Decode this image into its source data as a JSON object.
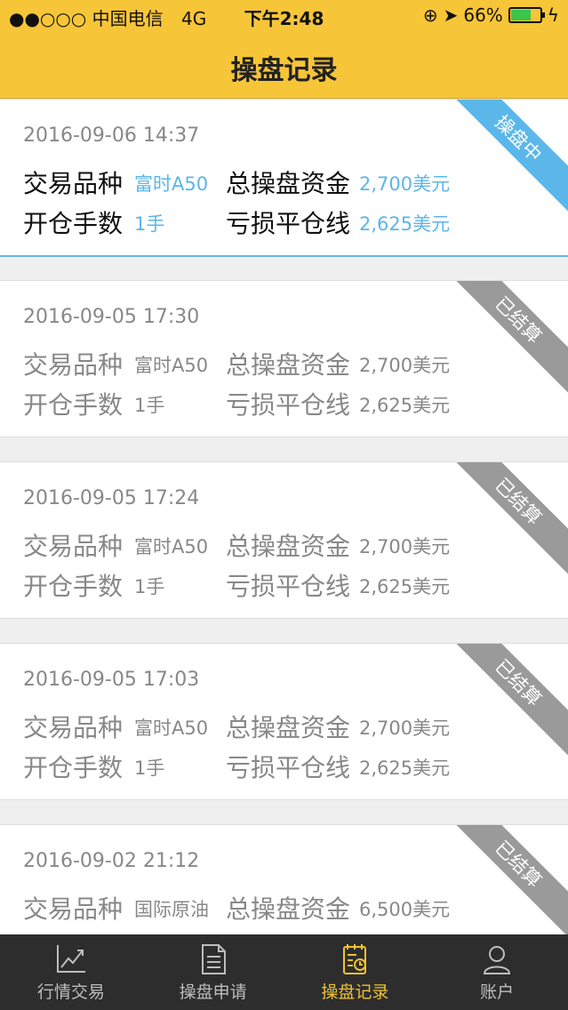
{
  "status": {
    "carrier": "●●○○○ 中国电信",
    "network": "4G",
    "time": "下午2:48",
    "battery": "66%"
  },
  "header": {
    "title": "操盘记录"
  },
  "records": [
    {
      "date": "2016-09-06 14:37",
      "status": "操盘中",
      "variety_label": "交易品种",
      "variety": "富时A50",
      "capital_label": "总操盘资金",
      "capital": "2,700美元",
      "lots_label": "开仓手数",
      "lots": "1手",
      "stop_label": "亏损平仓线",
      "stop": "2,625美元"
    },
    {
      "date": "2016-09-05 17:30",
      "status": "已结算",
      "variety_label": "交易品种",
      "variety": "富时A50",
      "capital_label": "总操盘资金",
      "capital": "2,700美元",
      "lots_label": "开仓手数",
      "lots": "1手",
      "stop_label": "亏损平仓线",
      "stop": "2,625美元"
    },
    {
      "date": "2016-09-05 17:24",
      "status": "已结算",
      "variety_label": "交易品种",
      "variety": "富时A50",
      "capital_label": "总操盘资金",
      "capital": "2,700美元",
      "lots_label": "开仓手数",
      "lots": "1手",
      "stop_label": "亏损平仓线",
      "stop": "2,625美元"
    },
    {
      "date": "2016-09-05 17:03",
      "status": "已结算",
      "variety_label": "交易品种",
      "variety": "富时A50",
      "capital_label": "总操盘资金",
      "capital": "2,700美元",
      "lots_label": "开仓手数",
      "lots": "1手",
      "stop_label": "亏损平仓线",
      "stop": "2,625美元"
    },
    {
      "date": "2016-09-02 21:12",
      "status": "已结算",
      "variety_label": "交易品种",
      "variety": "国际原油",
      "capital_label": "总操盘资金",
      "capital": "6,500美元"
    }
  ],
  "tabs": [
    {
      "label": "行情交易",
      "icon": "chart-icon"
    },
    {
      "label": "操盘申请",
      "icon": "document-icon"
    },
    {
      "label": "操盘记录",
      "icon": "record-icon",
      "active": true
    },
    {
      "label": "账户",
      "icon": "user-icon"
    }
  ],
  "colors": {
    "header": "#f7c538",
    "accent_blue": "#5bb7ea",
    "settled_gray": "#9a9a9a",
    "tab_active": "#f1c232"
  }
}
